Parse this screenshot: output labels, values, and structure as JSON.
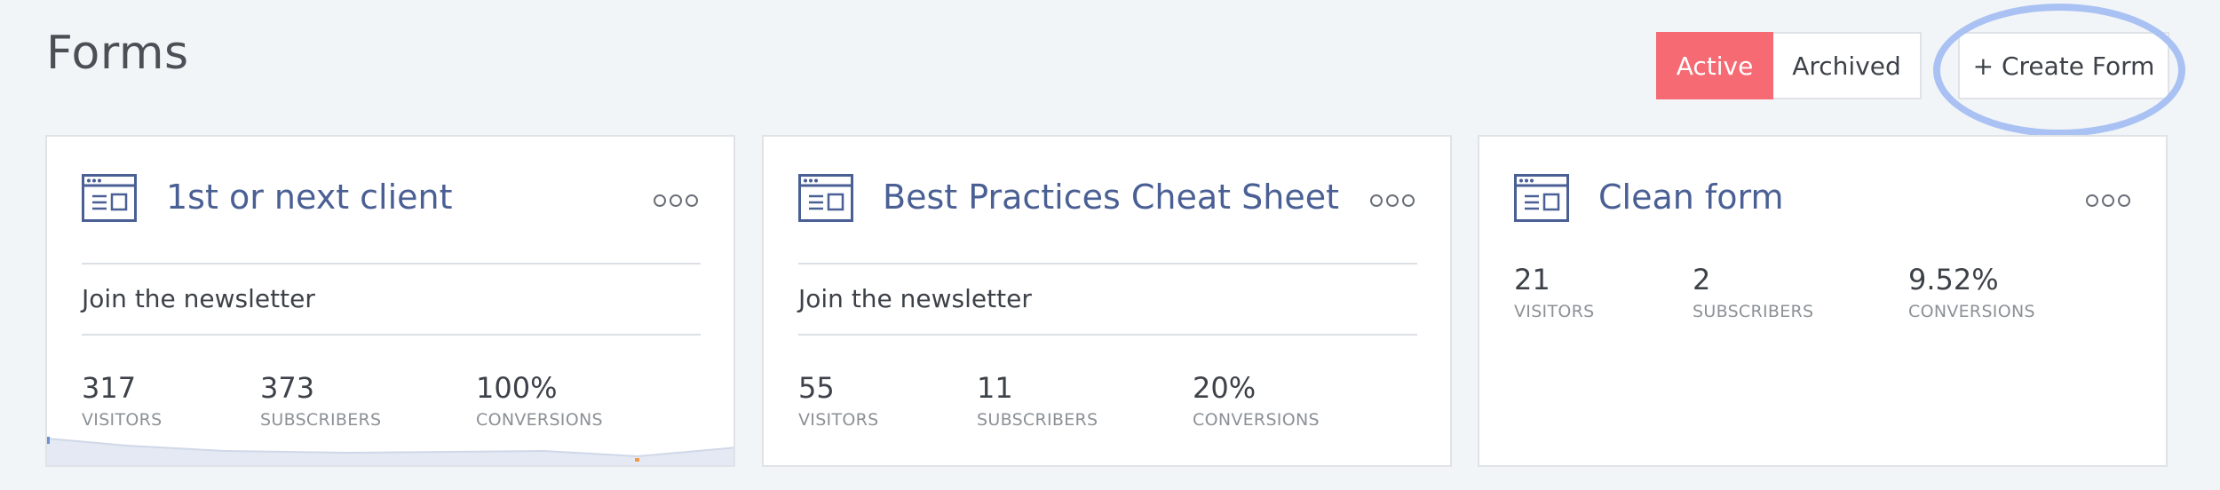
{
  "header": {
    "title": "Forms",
    "tabs": [
      {
        "label": "Active",
        "active": true
      },
      {
        "label": "Archived",
        "active": false
      }
    ],
    "create_label": "+ Create Form"
  },
  "colors": {
    "accent": "#f56a73",
    "title_blue": "#4a5f94",
    "highlight": "#a9c2f3"
  },
  "cards": [
    {
      "title": "1st or next client",
      "subtitle": "Join the newsletter",
      "stats": [
        {
          "value": "317",
          "label": "VISITORS"
        },
        {
          "value": "373",
          "label": "SUBSCRIBERS"
        },
        {
          "value": "100%",
          "label": "CONVERSIONS"
        }
      ]
    },
    {
      "title": "Best Practices Cheat Sheet",
      "subtitle": "Join the newsletter",
      "stats": [
        {
          "value": "55",
          "label": "VISITORS"
        },
        {
          "value": "11",
          "label": "SUBSCRIBERS"
        },
        {
          "value": "20%",
          "label": "CONVERSIONS"
        }
      ]
    },
    {
      "title": "Clean form",
      "subtitle": "",
      "stats": [
        {
          "value": "21",
          "label": "VISITORS"
        },
        {
          "value": "2",
          "label": "SUBSCRIBERS"
        },
        {
          "value": "9.52%",
          "label": "CONVERSIONS"
        }
      ]
    }
  ]
}
